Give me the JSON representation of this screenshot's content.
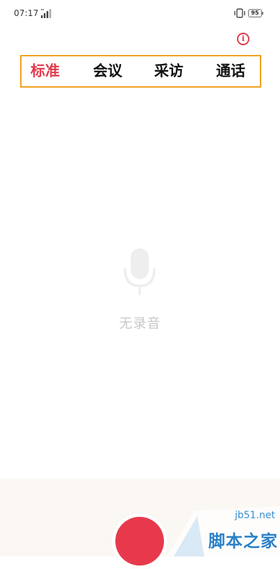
{
  "status_bar": {
    "time": "07:17",
    "battery": "95",
    "icons": [
      "signal-icon",
      "vibrate-icon",
      "battery-icon"
    ]
  },
  "header": {
    "info_icon": "info-icon",
    "info_glyph": "i"
  },
  "tabs": [
    {
      "label": "标准",
      "active": true
    },
    {
      "label": "会议",
      "active": false
    },
    {
      "label": "采访",
      "active": false
    },
    {
      "label": "通话",
      "active": false
    }
  ],
  "colors": {
    "accent": "#e23a4c",
    "tab_frame": "#f0a020",
    "empty_text": "#c8c8c8",
    "bottom_panel": "#fbf8f4"
  },
  "empty_state": {
    "icon": "microphone-icon",
    "text": "无录音"
  },
  "record": {
    "icon": "record-button-icon"
  },
  "watermark": {
    "url": "jb51.net",
    "text": "脚本之家"
  }
}
